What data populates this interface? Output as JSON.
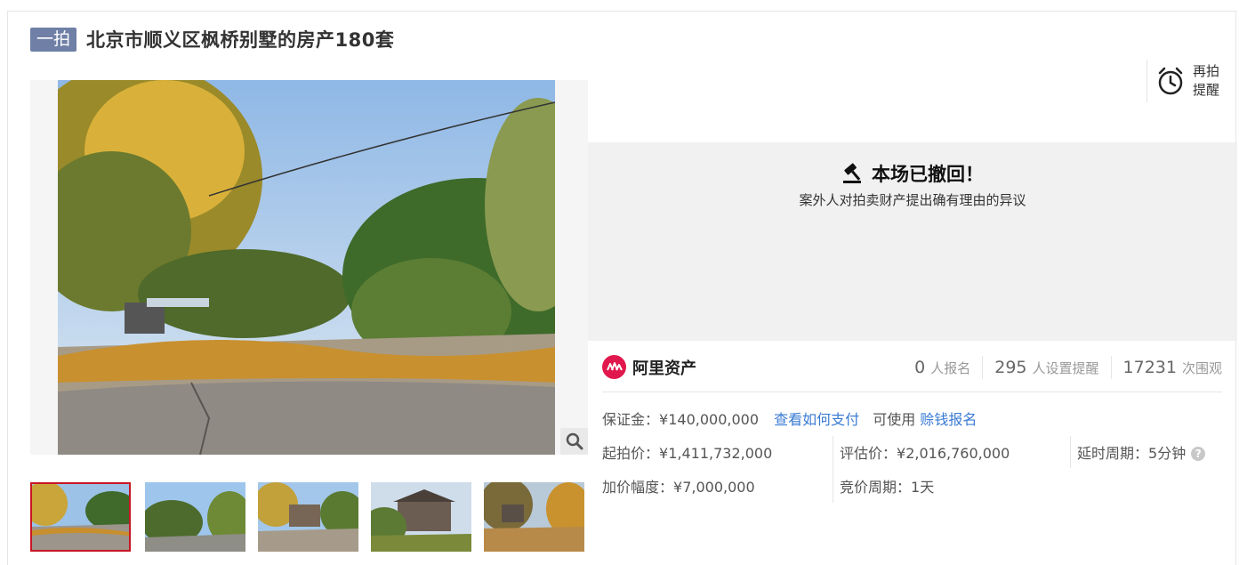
{
  "header": {
    "tag": "一拍",
    "title": "北京市顺义区枫桥别墅的房产180套"
  },
  "reminder": {
    "label_line1": "再拍",
    "label_line2": "提醒",
    "icon": "alarm-clock-icon"
  },
  "status": {
    "icon": "gavel-icon",
    "headline": "本场已撤回！",
    "reason": "案外人对拍卖财产提出确有理由的异议"
  },
  "organization": {
    "name": "阿里资产",
    "logo_color": "#e0184d"
  },
  "stats": [
    {
      "value": "0",
      "label": "人报名"
    },
    {
      "value": "295",
      "label": "人设置提醒"
    },
    {
      "value": "17231",
      "label": "次围观"
    }
  ],
  "deposit": {
    "label": "保证金",
    "value": "¥140,000,000",
    "pay_link": "查看如何支付",
    "can_use": "可使用",
    "earn_link": "赊钱报名"
  },
  "pricing": {
    "start_label": "起拍价",
    "start_value": "¥1,411,732,000",
    "appraisal_label": "评估价",
    "appraisal_value": "¥2,016,760,000",
    "delay_label": "延时周期",
    "delay_value": "5分钟",
    "increment_label": "加价幅度",
    "increment_value": "¥7,000,000",
    "bid_cycle_label": "竞价周期",
    "bid_cycle_value": "1天"
  },
  "separator": "：",
  "colors": {
    "tag_bg": "#6f7fa6",
    "link": "#3a7bd5",
    "active_thumb_border": "#c81623",
    "status_bg": "#f1f1f1"
  }
}
